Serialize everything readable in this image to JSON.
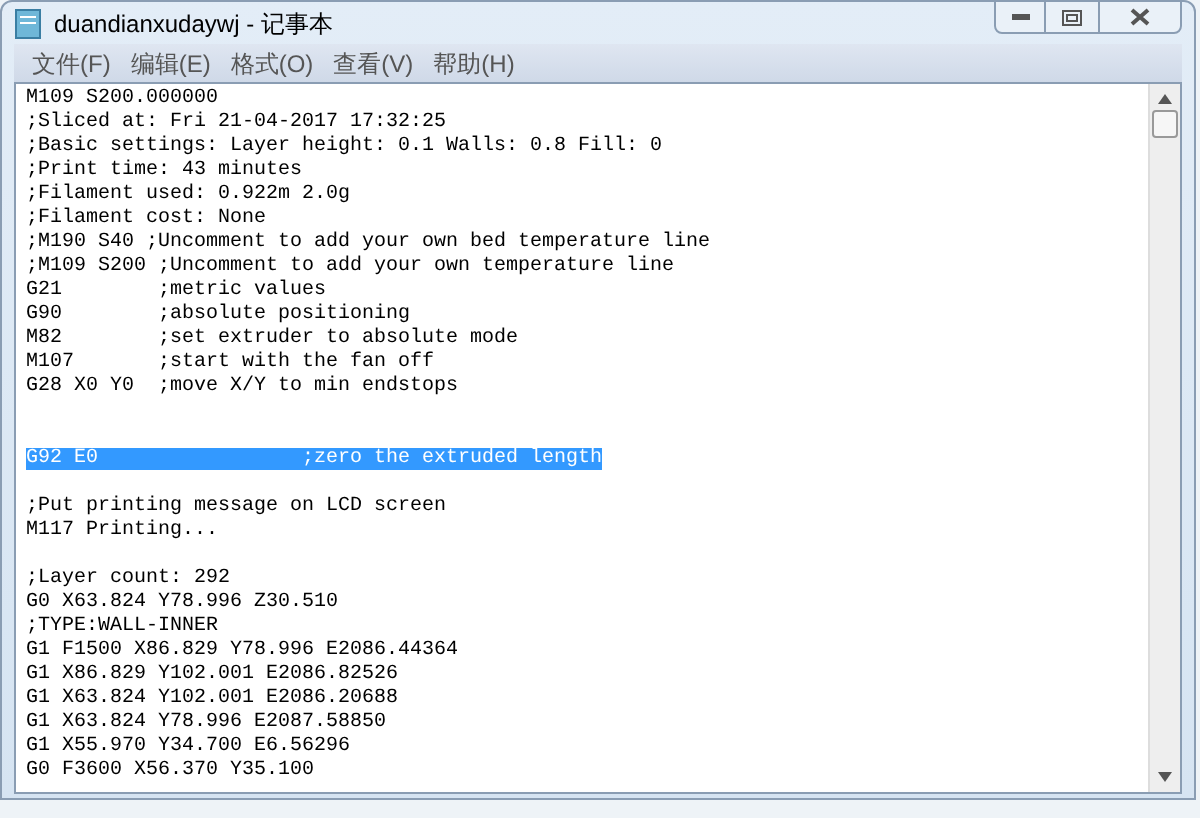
{
  "window": {
    "title": "duandianxudaywj - 记事本"
  },
  "menu": [
    "文件(F)",
    "编辑(E)",
    "格式(O)",
    "查看(V)",
    "帮助(H)"
  ],
  "lines": [
    {
      "kind": "code",
      "text": "M109 S200.000000",
      "selected": false
    },
    {
      "kind": "code",
      "text": ";Sliced at: Fri 21-04-2017 17:32:25",
      "selected": false
    },
    {
      "kind": "code",
      "text": ";Basic settings: Layer height: 0.1 Walls: 0.8 Fill: 0",
      "selected": false
    },
    {
      "kind": "code",
      "text": ";Print time: 43 minutes",
      "selected": false
    },
    {
      "kind": "code",
      "text": ";Filament used: 0.922m 2.0g",
      "selected": false
    },
    {
      "kind": "code",
      "text": ";Filament cost: None",
      "selected": false
    },
    {
      "kind": "code",
      "text": ";M190 S40 ;Uncomment to add your own bed temperature line",
      "selected": false
    },
    {
      "kind": "code",
      "text": ";M109 S200 ;Uncomment to add your own temperature line",
      "selected": false
    },
    {
      "kind": "code",
      "text": "G21        ;metric values",
      "selected": false
    },
    {
      "kind": "code",
      "text": "G90        ;absolute positioning",
      "selected": false
    },
    {
      "kind": "code",
      "text": "M82        ;set extruder to absolute mode",
      "selected": false
    },
    {
      "kind": "code",
      "text": "M107       ;start with the fan off",
      "selected": false
    },
    {
      "kind": "code",
      "text": "G28 X0 Y0  ;move X/Y to min endstops",
      "selected": false
    },
    {
      "kind": "blank"
    },
    {
      "kind": "blank"
    },
    {
      "kind": "code",
      "text": "G92 E0                 ;zero the extruded length",
      "selected": true
    },
    {
      "kind": "blank"
    },
    {
      "kind": "code",
      "text": ";Put printing message on LCD screen",
      "selected": false
    },
    {
      "kind": "code",
      "text": "M117 Printing...",
      "selected": false
    },
    {
      "kind": "blank"
    },
    {
      "kind": "code",
      "text": ";Layer count: 292",
      "selected": false
    },
    {
      "kind": "code",
      "text": "G0 X63.824 Y78.996 Z30.510",
      "selected": false
    },
    {
      "kind": "code",
      "text": ";TYPE:WALL-INNER",
      "selected": false
    },
    {
      "kind": "code",
      "text": "G1 F1500 X86.829 Y78.996 E2086.44364",
      "selected": false
    },
    {
      "kind": "code",
      "text": "G1 X86.829 Y102.001 E2086.82526",
      "selected": false
    },
    {
      "kind": "code",
      "text": "G1 X63.824 Y102.001 E2086.20688",
      "selected": false
    },
    {
      "kind": "code",
      "text": "G1 X63.824 Y78.996 E2087.58850",
      "selected": false
    },
    {
      "kind": "code",
      "text": "G1 X55.970 Y34.700 E6.56296",
      "selected": false
    },
    {
      "kind": "code",
      "text": "G0 F3600 X56.370 Y35.100",
      "selected": false
    }
  ]
}
